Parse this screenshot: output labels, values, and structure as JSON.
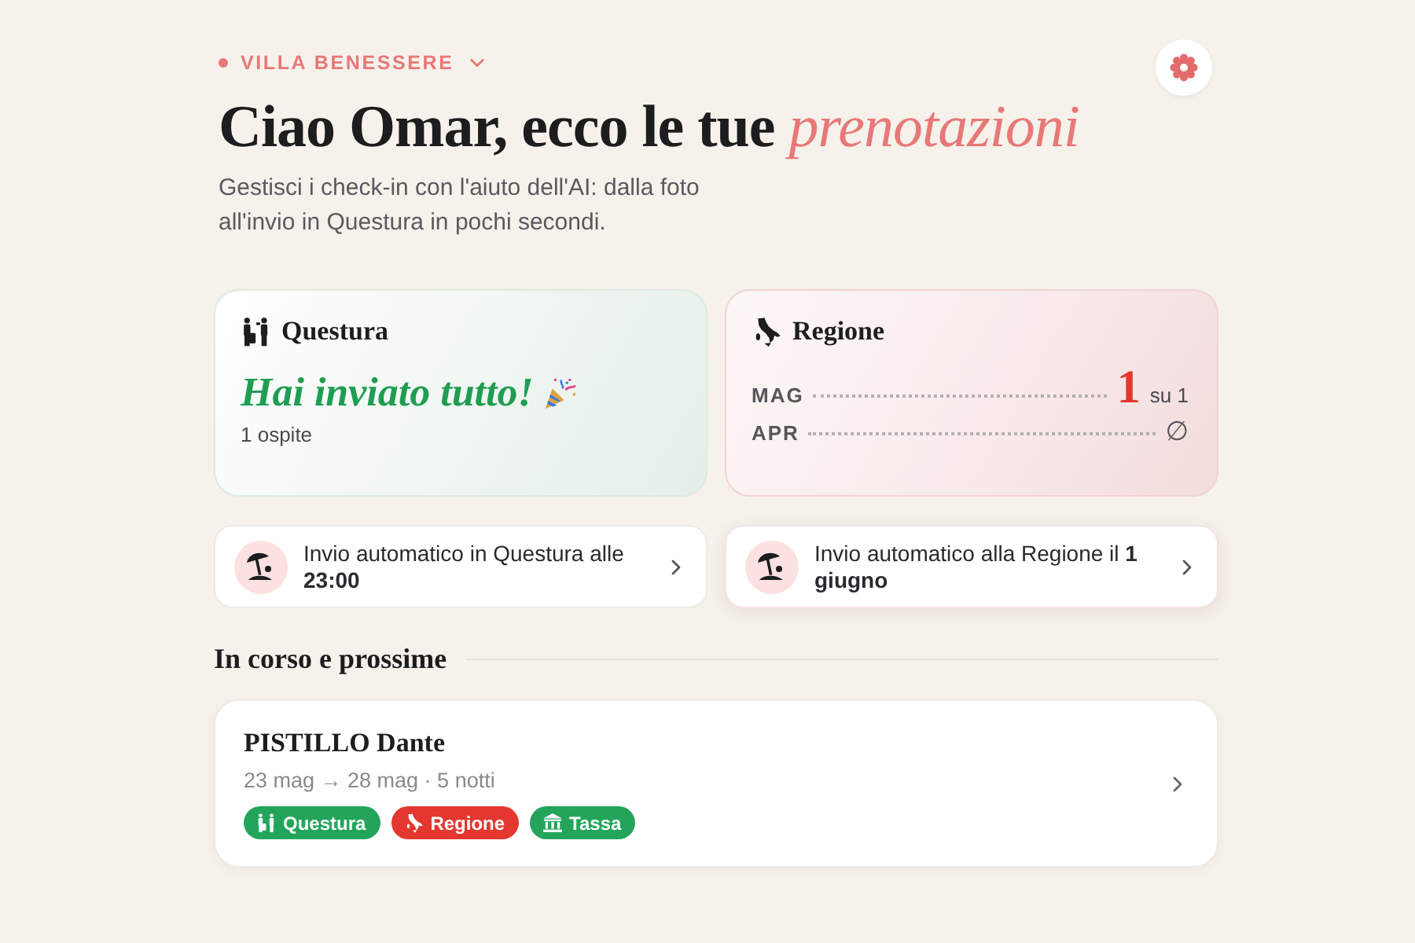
{
  "header": {
    "property": {
      "name": "VILLA BENESSERE"
    },
    "title": "Ciao Omar, ecco le tue",
    "title_highlight": "prenotazioni",
    "subtitle": "Gestisci i check-in con l'aiuto dell'AI: dalla foto all'invio in Questura in pochi secondi."
  },
  "status_cards": [
    {
      "kind": "questura",
      "title": "Questura",
      "message": "Hai inviato tutto!",
      "detail": "1 ospite"
    },
    {
      "kind": "regione",
      "title": "Regione",
      "months": [
        {
          "label": "MAG",
          "kind": "count",
          "value": "1",
          "total": "su 1"
        },
        {
          "label": "APR",
          "kind": "none",
          "value": "∅"
        }
      ]
    }
  ],
  "auto_sends": [
    {
      "text": "Invio automatico in Questura alle **23:00**"
    },
    {
      "text": "Invio automatico alla Regione il **1 giugno**"
    }
  ],
  "section": {
    "title": "In corso e prossime"
  },
  "bookings": [
    {
      "guest": "PISTILLO Dante",
      "dates": "23 mag → 28 mag · 5 notti",
      "tags": [
        {
          "kind": "questura",
          "label": "Questura",
          "color": "#22a55a"
        },
        {
          "kind": "regione",
          "label": "Regione",
          "color": "#e3372f"
        },
        {
          "kind": "tassa",
          "label": "Tassa",
          "color": "#22a55a"
        }
      ]
    }
  ]
}
